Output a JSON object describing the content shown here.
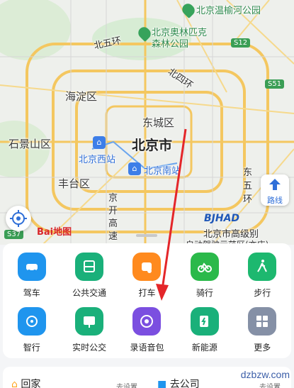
{
  "map": {
    "districts": [
      "海淀区",
      "东城区",
      "石景山区",
      "丰台区"
    ],
    "city": "北京市",
    "parks": [
      "北京温榆河公园",
      "北京奥林匹克",
      "森林公园"
    ],
    "roads": [
      "北五环",
      "北四环",
      "开高速",
      "东五环"
    ],
    "road_chars": [
      "东",
      "五",
      "环"
    ],
    "road_col": [
      "京",
      "开",
      "高",
      "速"
    ],
    "shields": [
      "S12",
      "S51",
      "S37"
    ],
    "stations": [
      "北京西站",
      "北京南站"
    ],
    "poi": "北京市高级别",
    "poi_sub": "自动驾驶示范区(亦庄)",
    "route_label": "路线",
    "baidu_logo": "Bai地图",
    "bjhad_logo": "BJHAD"
  },
  "tiles": [
    {
      "label": "驾车",
      "color": "#1f95ee",
      "icon": "car-icon"
    },
    {
      "label": "公共交通",
      "color": "#1ab07a",
      "icon": "bus-icon"
    },
    {
      "label": "打车",
      "color": "#ff8a1e",
      "icon": "taxi-icon"
    },
    {
      "label": "骑行",
      "color": "#2bb94a",
      "icon": "bike-icon"
    },
    {
      "label": "步行",
      "color": "#1db86f",
      "icon": "walk-icon"
    },
    {
      "label": "智行",
      "color": "#1f95ee",
      "icon": "smart-travel-icon"
    },
    {
      "label": "实时公交",
      "color": "#1ab07a",
      "icon": "realtime-bus-icon"
    },
    {
      "label": "录语音包",
      "color": "#7b4fe0",
      "icon": "voice-pack-icon"
    },
    {
      "label": "新能源",
      "color": "#1ab07a",
      "icon": "ev-charging-icon"
    },
    {
      "label": "更多",
      "color": "#8590a6",
      "icon": "more-grid-icon"
    }
  ],
  "bottom": {
    "home_label": "回家",
    "home_sub": "去设置",
    "work_label": "去公司",
    "work_sub": "去设置"
  },
  "watermark": "dzbzw.com"
}
